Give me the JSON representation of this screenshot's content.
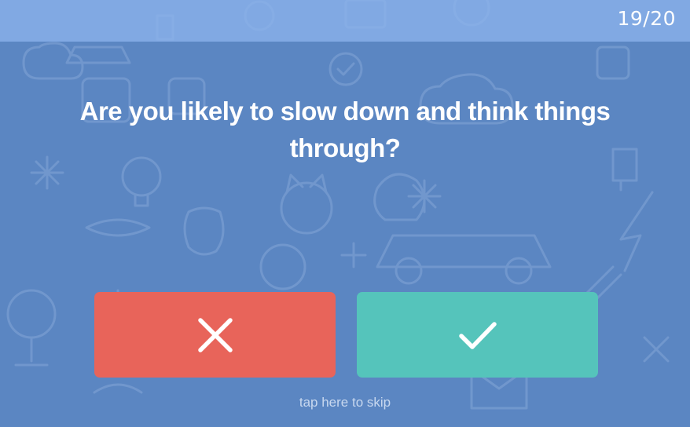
{
  "progress": {
    "counter_text": "19/20",
    "current": 19,
    "total": 20
  },
  "question": {
    "text": "Are you likely to slow down and think things through?"
  },
  "answers": {
    "no": {
      "icon": "x-icon",
      "color": "#e8645a"
    },
    "yes": {
      "icon": "checkmark-icon",
      "color": "#55c4bb"
    }
  },
  "skip": {
    "label": "tap here to skip"
  },
  "colors": {
    "background": "#5b86c2",
    "top_bar": "#8cb4ec",
    "text": "#ffffff"
  }
}
